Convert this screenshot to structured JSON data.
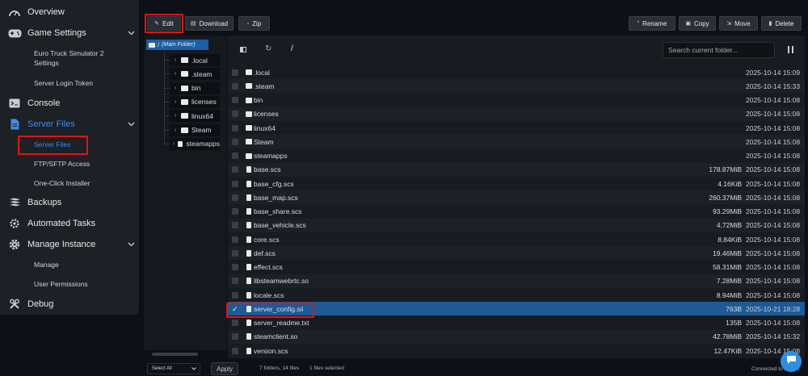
{
  "sidebar": {
    "overview": "Overview",
    "game_settings": "Game Settings",
    "ets2_settings": "Euro Truck Simulator 2 Settings",
    "ets2_settings_line1": "Euro Truck Simulator 2",
    "ets2_settings_line2": "Settings",
    "server_login_token": "Server Login Token",
    "console": "Console",
    "server_files_header": "Server Files",
    "server_files": "Server Files",
    "ftp_access": "FTP/SFTP Access",
    "one_click_installer": "One-Click Installer",
    "backups": "Backups",
    "automated_tasks": "Automated Tasks",
    "manage_instance": "Manage Instance",
    "manage": "Manage",
    "user_permissions": "User Permissions",
    "debug": "Debug"
  },
  "toolbar": {
    "edit": "Edit",
    "download": "Download",
    "zip": "Zip",
    "rename": "Rename",
    "copy": "Copy",
    "move": "Move",
    "delete": "Delete"
  },
  "tree": {
    "root_slash": "/",
    "root_label": "(Main Folder)",
    "folders": [
      ".local",
      ".steam",
      "bin",
      "licenses",
      "linux64",
      "Steam",
      "steamapps"
    ]
  },
  "browser": {
    "path": "/",
    "search_placeholder": "Search current folder...",
    "files": [
      {
        "name": ".local",
        "size": "",
        "date": "2025-10-14 15:09",
        "type": "folder"
      },
      {
        "name": ".steam",
        "size": "",
        "date": "2025-10-14 15:33",
        "type": "folder"
      },
      {
        "name": "bin",
        "size": "",
        "date": "2025-10-14 15:08",
        "type": "folder"
      },
      {
        "name": "licenses",
        "size": "",
        "date": "2025-10-14 15:08",
        "type": "folder"
      },
      {
        "name": "linux64",
        "size": "",
        "date": "2025-10-14 15:08",
        "type": "folder"
      },
      {
        "name": "Steam",
        "size": "",
        "date": "2025-10-14 15:08",
        "type": "folder"
      },
      {
        "name": "steamapps",
        "size": "",
        "date": "2025-10-14 15:08",
        "type": "folder"
      },
      {
        "name": "base.scs",
        "size": "178.87MiB",
        "date": "2025-10-14 15:08",
        "type": "file"
      },
      {
        "name": "base_cfg.scs",
        "size": "4.16KiB",
        "date": "2025-10-14 15:08",
        "type": "file"
      },
      {
        "name": "base_map.scs",
        "size": "260.37MiB",
        "date": "2025-10-14 15:08",
        "type": "file"
      },
      {
        "name": "base_share.scs",
        "size": "93.29MiB",
        "date": "2025-10-14 15:08",
        "type": "file"
      },
      {
        "name": "base_vehicle.scs",
        "size": "4.72MiB",
        "date": "2025-10-14 15:08",
        "type": "file"
      },
      {
        "name": "core.scs",
        "size": "8.84KiB",
        "date": "2025-10-14 15:08",
        "type": "file"
      },
      {
        "name": "def.scs",
        "size": "19.46MiB",
        "date": "2025-10-14 15:08",
        "type": "file"
      },
      {
        "name": "effect.scs",
        "size": "58.31MiB",
        "date": "2025-10-14 15:08",
        "type": "file"
      },
      {
        "name": "libsteamwebrtc.so",
        "size": "7.28MiB",
        "date": "2025-10-14 15:08",
        "type": "file"
      },
      {
        "name": "locale.scs",
        "size": "8.94MiB",
        "date": "2025-10-14 15:08",
        "type": "file"
      },
      {
        "name": "server_config.sii",
        "size": "763B",
        "date": "2025-10-21 18:28",
        "type": "file",
        "selected": true
      },
      {
        "name": "server_readme.txt",
        "size": "135B",
        "date": "2025-10-14 15:08",
        "type": "file"
      },
      {
        "name": "steamclient.so",
        "size": "42.78MiB",
        "date": "2025-10-14 15:32",
        "type": "file"
      },
      {
        "name": "version.scs",
        "size": "12.47KiB",
        "date": "2025-10-14 15:08",
        "type": "file"
      }
    ]
  },
  "footer": {
    "select_value": "Select All",
    "apply": "Apply",
    "summary": "7 folders, 14 files",
    "selected": "1 files selected",
    "connection": "Connected to socket"
  }
}
